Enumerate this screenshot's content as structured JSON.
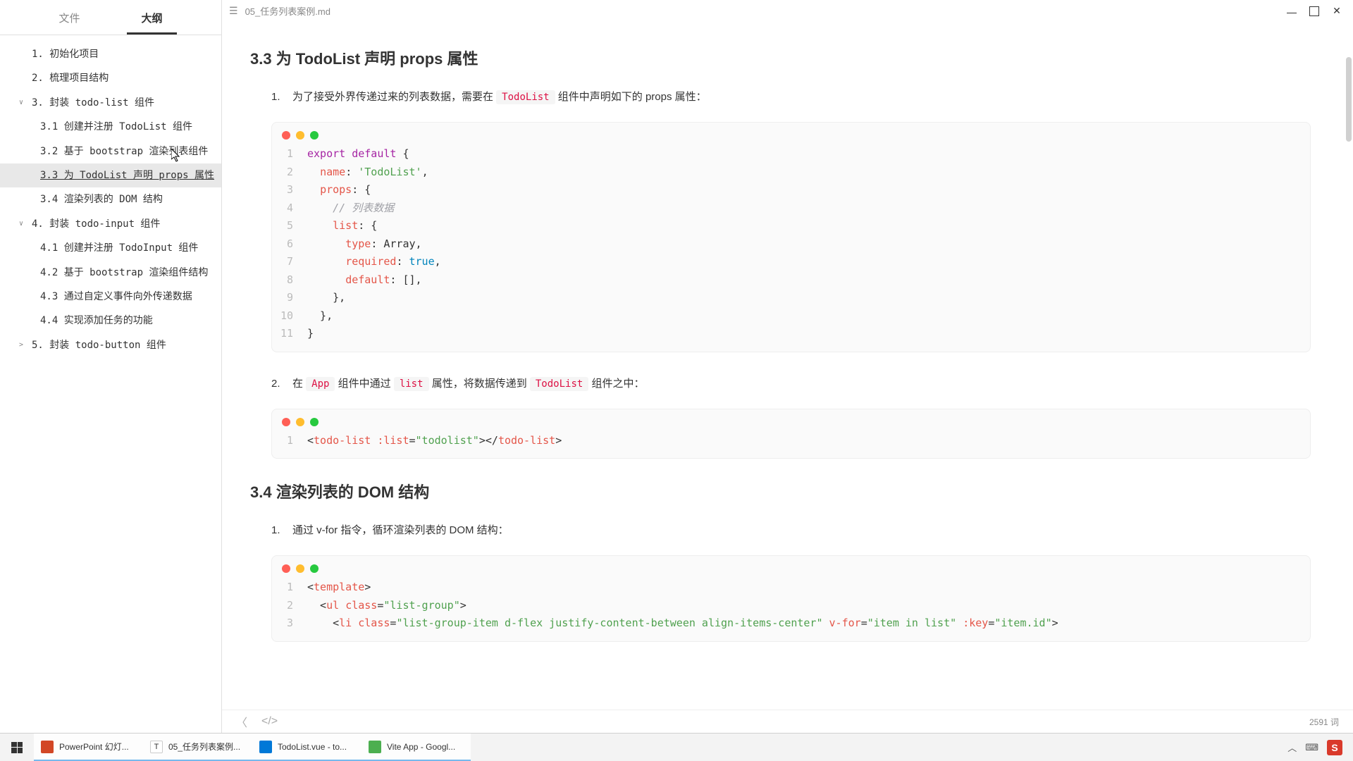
{
  "titlebar": {
    "filename": "05_任务列表案例.md"
  },
  "tabs": {
    "file": "文件",
    "outline": "大纲"
  },
  "outline": [
    {
      "label": "1. 初始化项目",
      "level": 1,
      "chev": "",
      "active": false
    },
    {
      "label": "2. 梳理项目结构",
      "level": 1,
      "chev": "",
      "active": false
    },
    {
      "label": "3. 封装 todo-list 组件",
      "level": 1,
      "chev": "∨",
      "active": false
    },
    {
      "label": "3.1 创建并注册 TodoList 组件",
      "level": 2,
      "chev": "",
      "active": false
    },
    {
      "label": "3.2 基于 bootstrap 渲染列表组件",
      "level": 2,
      "chev": "",
      "active": false
    },
    {
      "label": "3.3 为 TodoList 声明 props 属性",
      "level": 2,
      "chev": "",
      "active": true
    },
    {
      "label": "3.4 渲染列表的 DOM 结构",
      "level": 2,
      "chev": "",
      "active": false
    },
    {
      "label": "4. 封装 todo-input 组件",
      "level": 1,
      "chev": "∨",
      "active": false
    },
    {
      "label": "4.1 创建并注册 TodoInput 组件",
      "level": 2,
      "chev": "",
      "active": false
    },
    {
      "label": "4.2 基于 bootstrap 渲染组件结构",
      "level": 2,
      "chev": "",
      "active": false
    },
    {
      "label": "4.3 通过自定义事件向外传递数据",
      "level": 2,
      "chev": "",
      "active": false
    },
    {
      "label": "4.4 实现添加任务的功能",
      "level": 2,
      "chev": "",
      "active": false
    },
    {
      "label": "5. 封装 todo-button 组件",
      "level": 1,
      "chev": ">",
      "active": false
    }
  ],
  "content": {
    "h33": "3.3 为 TodoList 声明 props 属性",
    "p1_num": "1.",
    "p1_a": "为了接受外界传递过来的列表数据，需要在 ",
    "p1_code": "TodoList",
    "p1_b": " 组件中声明如下的 props 属性：",
    "code1": [
      {
        "n": "1",
        "html": "<span class='tk-kw'>export</span> <span class='tk-kw'>default</span> {"
      },
      {
        "n": "2",
        "html": "  <span class='tk-attr'>name</span>: <span class='tk-str'>'TodoList'</span>,"
      },
      {
        "n": "3",
        "html": "  <span class='tk-attr'>props</span>: {"
      },
      {
        "n": "4",
        "html": "    <span class='tk-cmt'>// 列表数据</span>"
      },
      {
        "n": "5",
        "html": "    <span class='tk-attr'>list</span>: {"
      },
      {
        "n": "6",
        "html": "      <span class='tk-attr'>type</span>: Array,"
      },
      {
        "n": "7",
        "html": "      <span class='tk-attr'>required</span>: <span class='tk-bool'>true</span>,"
      },
      {
        "n": "8",
        "html": "      <span class='tk-attr'>default</span>: [],"
      },
      {
        "n": "9",
        "html": "    },"
      },
      {
        "n": "10",
        "html": "  },"
      },
      {
        "n": "11",
        "html": "}"
      }
    ],
    "p2_num": "2.",
    "p2_a": "在 ",
    "p2_c1": "App",
    "p2_b": " 组件中通过 ",
    "p2_c2": "list",
    "p2_c": " 属性，将数据传递到 ",
    "p2_c3": "TodoList",
    "p2_d": " 组件之中：",
    "code2": [
      {
        "n": "1",
        "html": "&lt;<span class='tk-tag'>todo-list</span> <span class='tk-attr'>:list</span>=<span class='tk-str'>\"todolist\"</span>&gt;&lt;/<span class='tk-tag'>todo-list</span>&gt;"
      }
    ],
    "h34": "3.4 渲染列表的 DOM 结构",
    "p3_num": "1.",
    "p3_a": "通过 v-for 指令，循环渲染列表的 DOM 结构：",
    "code3": [
      {
        "n": "1",
        "html": "&lt;<span class='tk-tag'>template</span>&gt;"
      },
      {
        "n": "2",
        "html": "  &lt;<span class='tk-tag'>ul</span> <span class='tk-attr'>class</span>=<span class='tk-str'>\"list-group\"</span>&gt;"
      },
      {
        "n": "3",
        "html": "    &lt;<span class='tk-tag'>li</span> <span class='tk-attr'>class</span>=<span class='tk-str'>\"list-group-item d-flex justify-content-between align-items-center\"</span> <span class='tk-attr'>v-for</span>=<span class='tk-str'>\"item in list\"</span> <span class='tk-attr'>:key</span>=<span class='tk-str'>\"item.id\"</span>&gt;"
      }
    ]
  },
  "footer": {
    "wordcount": "2591 词"
  },
  "taskbar": {
    "items": [
      {
        "label": "PowerPoint 幻灯...",
        "color": "#d24726",
        "active": true
      },
      {
        "label": "05_任务列表案例...",
        "color": "#ffffff",
        "active": true,
        "text_icon": "T"
      },
      {
        "label": "TodoList.vue - to...",
        "color": "#0078d7",
        "active": true
      },
      {
        "label": "Vite App - Googl...",
        "color": "#4caf50",
        "active": true
      }
    ],
    "ime": "S"
  }
}
